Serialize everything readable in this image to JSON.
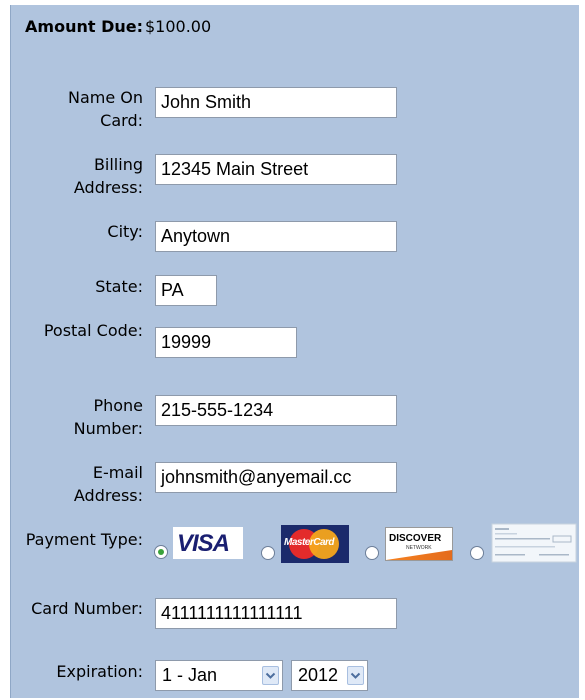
{
  "amount": {
    "label": "Amount Due:",
    "value": "$100.00"
  },
  "fields": {
    "name_label": "Name On Card:",
    "name_value": "John Smith",
    "billing_label": "Billing Address:",
    "billing_value": "12345 Main Street",
    "city_label": "City:",
    "city_value": "Anytown",
    "state_label": "State:",
    "state_value": "PA",
    "postal_label": "Postal Code:",
    "postal_value": "19999",
    "phone_label": "Phone Number:",
    "phone_value": "215-555-1234",
    "email_label": "E-mail Address:",
    "email_value": "johnsmith@anyemail.cc",
    "payment_label": "Payment Type:",
    "card_label": "Card Number:",
    "card_value": "4111111111111111",
    "expiration_label": "Expiration:"
  },
  "payment_types": {
    "selected": "visa",
    "visa_text": "VISA",
    "mastercard_text": "MasterCard",
    "discover_text": "DISCOVER",
    "discover_subtext": "NETWORK"
  },
  "expiration": {
    "month": "1 - Jan",
    "year": "2012"
  },
  "colors": {
    "panel": "#b0c4de",
    "visa_blue": "#1a1f71",
    "radio_selected": "#3aa23a"
  }
}
